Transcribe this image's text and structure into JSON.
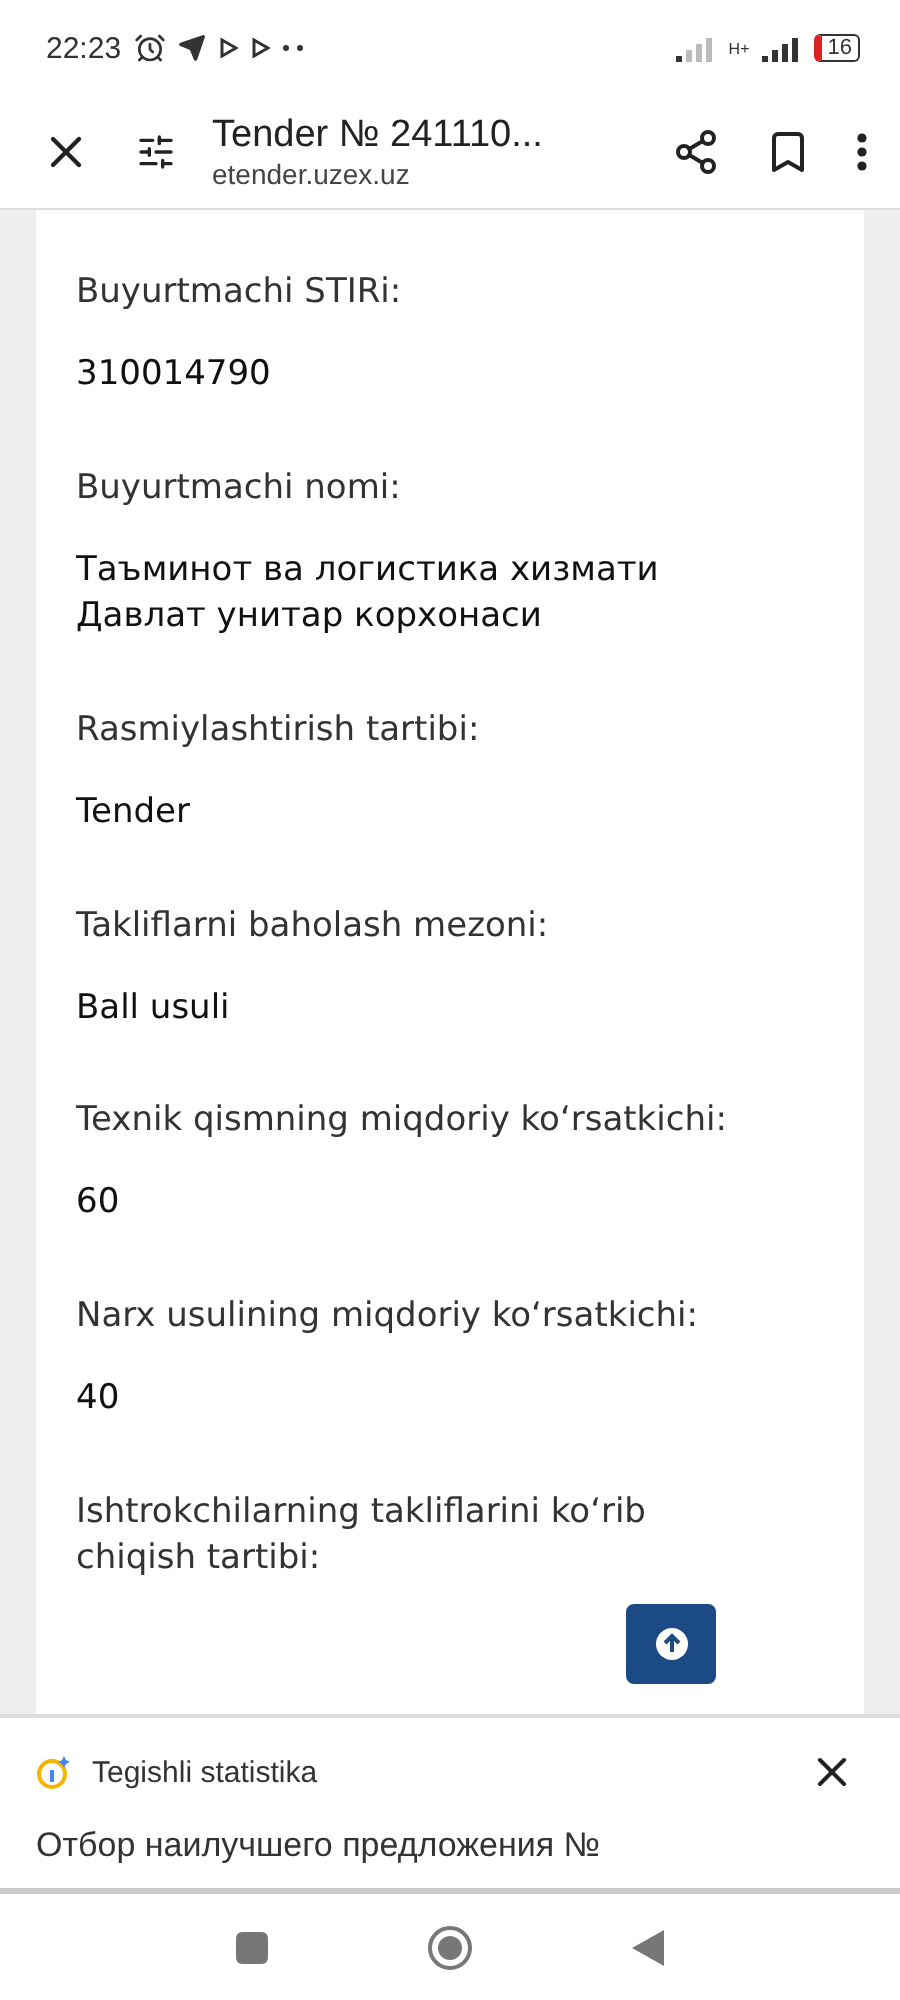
{
  "status_bar": {
    "time": "22:23",
    "battery": "16",
    "network": "H+"
  },
  "header": {
    "title": "Tender № 241110...",
    "url": "etender.uzex.uz"
  },
  "fields": [
    {
      "label": "Buyurtmachi STIRi:",
      "value": "310014790"
    },
    {
      "label": "Buyurtmachi nomi:",
      "value": "Таъминот ва логистика хизмати Давлат унитар корхонаси"
    },
    {
      "label": "Rasmiylashtirish tartibi:",
      "value": "Tender"
    },
    {
      "label": "Takliflarni baholash mezoni:",
      "value": "Ball usuli"
    },
    {
      "label": "Texnik qismning miqdoriy ko‘rsatkichi:",
      "value": "60"
    },
    {
      "label": "Narx usulining miqdoriy ko‘rsatkichi:",
      "value": "40"
    },
    {
      "label": "Ishtrokchilarning takliflarini ko‘rib chiqish tartibi:"
    }
  ],
  "panel": {
    "title": "Tegishli statistika",
    "text": "Отбор наилучшего предложения №"
  }
}
